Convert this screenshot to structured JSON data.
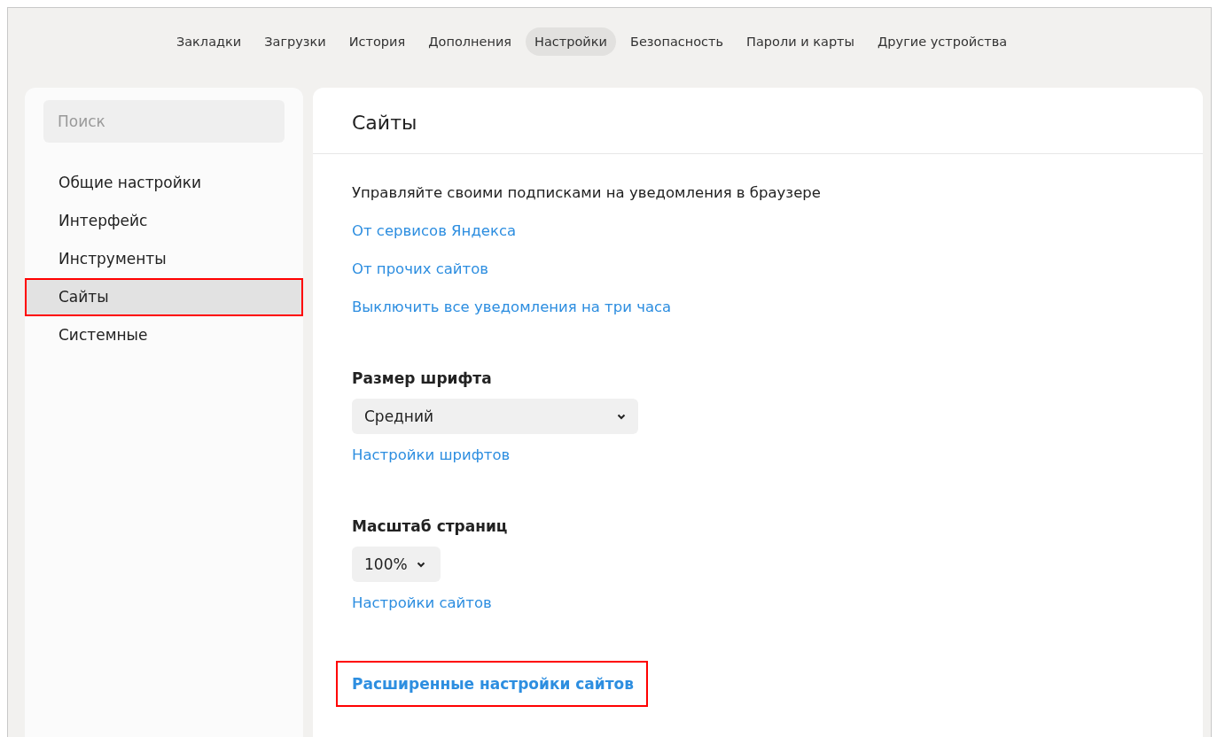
{
  "nav": {
    "tabs": [
      {
        "label": "Закладки",
        "selected": false
      },
      {
        "label": "Загрузки",
        "selected": false
      },
      {
        "label": "История",
        "selected": false
      },
      {
        "label": "Дополнения",
        "selected": false
      },
      {
        "label": "Настройки",
        "selected": true
      },
      {
        "label": "Безопасность",
        "selected": false
      },
      {
        "label": "Пароли и карты",
        "selected": false
      },
      {
        "label": "Другие устройства",
        "selected": false
      }
    ]
  },
  "sidebar": {
    "search": {
      "placeholder": "Поиск"
    },
    "items": [
      {
        "label": "Общие настройки",
        "selected": false,
        "highlighted": false
      },
      {
        "label": "Интерфейс",
        "selected": false,
        "highlighted": false
      },
      {
        "label": "Инструменты",
        "selected": false,
        "highlighted": false
      },
      {
        "label": "Сайты",
        "selected": true,
        "highlighted": true
      },
      {
        "label": "Системные",
        "selected": false,
        "highlighted": false
      }
    ]
  },
  "main": {
    "title": "Сайты",
    "notifications": {
      "description": "Управляйте своими подписками на уведомления в браузере",
      "links": [
        "От сервисов Яндекса",
        "От прочих сайтов",
        "Выключить все уведомления на три часа"
      ]
    },
    "sections": [
      {
        "heading": "Размер шрифта",
        "select": {
          "value": "Средний",
          "kind": "wide"
        },
        "link": "Настройки шрифтов"
      },
      {
        "heading": "Масштаб страниц",
        "select": {
          "value": "100%",
          "kind": "compact"
        },
        "link": "Настройки сайтов"
      }
    ],
    "advanced_link": {
      "label": "Расширенные настройки сайтов",
      "highlighted": true
    }
  }
}
